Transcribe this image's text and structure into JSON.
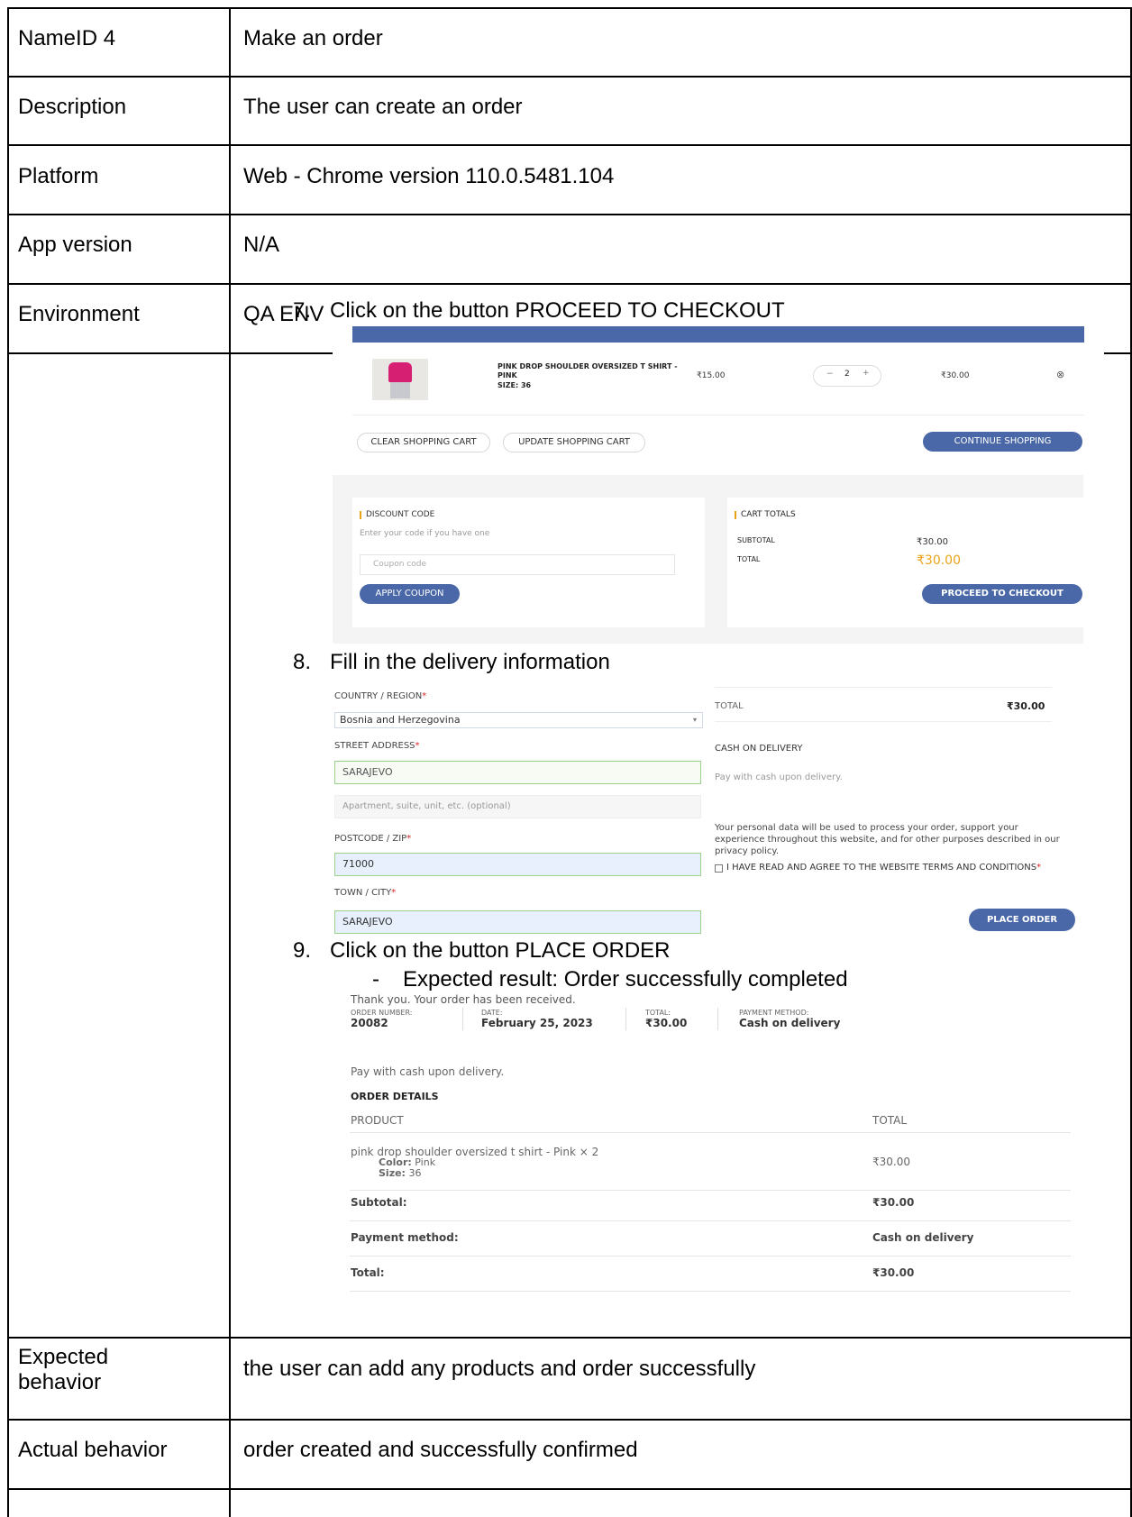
{
  "rows": {
    "nameid": {
      "label": "NameID 4",
      "value": "Make an order"
    },
    "description": {
      "label": "Description",
      "value": "The user can create an order"
    },
    "platform": {
      "label": "Platform",
      "value": "Web - Chrome version 110.0.5481.104"
    },
    "app_version": {
      "label": "App version",
      "value": "N/A"
    },
    "environment": {
      "label": "Environment",
      "value": "QA ENV"
    },
    "expected": {
      "label_1": "Expected",
      "label_2": "behavior",
      "value": "the user can add any products and order successfully"
    },
    "actual": {
      "label": "Actual behavior",
      "value": "order created and successfully confirmed"
    }
  },
  "steps": {
    "s7": {
      "num": "7.",
      "text": "Click on the button PROCEED TO CHECKOUT"
    },
    "s8": {
      "num": "8.",
      "text": "Fill in the delivery information"
    },
    "s9": {
      "num": "9.",
      "text": "Click on the button  PLACE ORDER"
    },
    "s9_sub": {
      "bullet": "-",
      "text": "Expected result: Order successfully completed"
    }
  },
  "cart": {
    "product_name_1": "PINK DROP SHOULDER OVERSIZED T SHIRT -",
    "product_name_2": "PINK",
    "product_size": "SIZE: 36",
    "price": "₹15.00",
    "qty_minus": "−",
    "qty": "2",
    "qty_plus": "+",
    "line_total": "₹30.00",
    "remove_icon": "⊗",
    "clear_btn": "CLEAR SHOPPING CART",
    "update_btn": "UPDATE SHOPPING CART",
    "continue_btn": "CONTINUE SHOPPING",
    "discount_title": "DISCOUNT CODE",
    "discount_hint": "Enter your code if you have one",
    "coupon_placeholder": "Coupon code",
    "apply_btn": "APPLY COUPON",
    "totals_title": "CART TOTALS",
    "subtotal_label": "SUBTOTAL",
    "subtotal_value": "₹30.00",
    "total_label": "TOTAL",
    "total_value": "₹30.00",
    "checkout_btn": "PROCEED TO CHECKOUT",
    "accent": "#e8a317",
    "button_color": "#4a68a8"
  },
  "delivery": {
    "country_label": "COUNTRY / REGION",
    "country_value": "Bosnia and Herzegovina",
    "street_label": "STREET ADDRESS",
    "street_value": "SARAJEVO",
    "apt_placeholder": "Apartment, suite, unit, etc. (optional)",
    "postcode_label": "POSTCODE / ZIP",
    "postcode_value": "71000",
    "town_label": "TOWN / CITY",
    "town_value": "SARAJEVO",
    "required_mark": "*",
    "total_label": "TOTAL",
    "total_value": "₹30.00",
    "payment_title": "CASH ON DELIVERY",
    "payment_desc": "Pay with cash upon delivery.",
    "privacy_1": "Your personal data will be used to process your order, support your",
    "privacy_2": "experience throughout this website, and for other purposes described in our",
    "privacy_3": "privacy policy.",
    "terms": "I HAVE READ AND AGREE TO THE WEBSITE TERMS AND CONDITIONS",
    "place_btn": "PLACE ORDER"
  },
  "order": {
    "thanks": "Thank you. Your order has been received.",
    "number_label": "ORDER NUMBER:",
    "number_value": "20082",
    "date_label": "DATE:",
    "date_value": "February 25, 2023",
    "total_label": "TOTAL:",
    "total_value": "₹30.00",
    "method_label": "PAYMENT METHOD:",
    "method_value": "Cash on delivery",
    "pay_note": "Pay with cash upon delivery.",
    "details_title": "ORDER DETAILS",
    "col_product": "PRODUCT",
    "col_total": "TOTAL",
    "item_name": "pink drop shoulder oversized t shirt - Pink × 2",
    "item_color_label": "Color:",
    "item_color_value": "Pink",
    "item_size_label": "Size:",
    "item_size_value": "36",
    "item_total": "₹30.00",
    "subtotal_label": "Subtotal:",
    "subtotal_value": "₹30.00",
    "payment_label": "Payment method:",
    "payment_value": "Cash on delivery",
    "total_row_label": "Total:",
    "total_row_value": "₹30.00"
  }
}
